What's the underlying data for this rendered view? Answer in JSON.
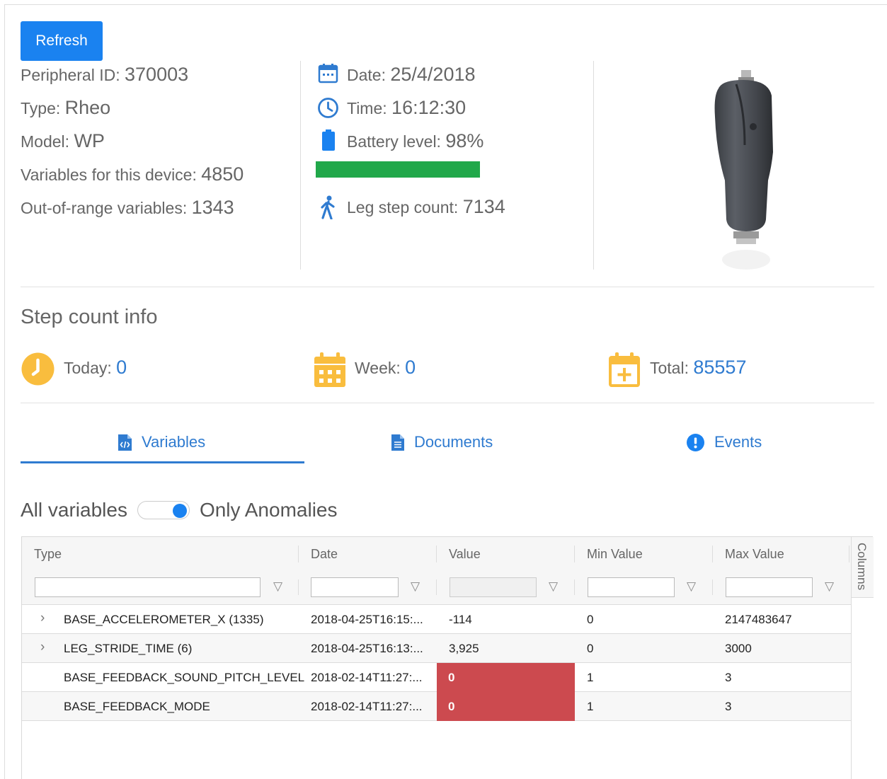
{
  "toolbar": {
    "refresh_label": "Refresh"
  },
  "device_info": {
    "peripheral_label": "Peripheral ID: ",
    "peripheral_value": "370003",
    "type_label": "Type: ",
    "type_value": "Rheo",
    "model_label": "Model: ",
    "model_value": "WP",
    "variables_label": "Variables for this device: ",
    "variables_value": "4850",
    "out_of_range_label": "Out-of-range variables: ",
    "out_of_range_value": "1343"
  },
  "status": {
    "date_label": "Date: ",
    "date_value": "25/4/2018",
    "time_label": "Time: ",
    "time_value": "16:12:30",
    "battery_label": "Battery level: ",
    "battery_value": "98%",
    "battery_level": 0.98,
    "battery_color": "#21a84a",
    "leg_step_label": "Leg step count: ",
    "leg_step_value": "7134"
  },
  "step_count": {
    "title": "Step count info",
    "today_label": "Today: ",
    "today_value": "0",
    "week_label": "Week: ",
    "week_value": "0",
    "total_label": "Total: ",
    "total_value": "85557"
  },
  "tabs": [
    {
      "label": "Variables",
      "icon": "code-file-icon",
      "active": true
    },
    {
      "label": "Documents",
      "icon": "document-icon",
      "active": false
    },
    {
      "label": "Events",
      "icon": "exclamation-circle-icon",
      "active": false
    }
  ],
  "filter_toggle": {
    "left_label": "All variables",
    "right_label": "Only Anomalies",
    "checked": true
  },
  "grid": {
    "columns": [
      "Type",
      "Date",
      "Value",
      "Min Value",
      "Max Value"
    ],
    "side_panel_label": "Columns",
    "rows": [
      {
        "type": "BASE_ACCELEROMETER_X (1335)",
        "date": "2018-04-25T16:15:...",
        "value": "-114",
        "min": "0",
        "max": "2147483647",
        "expandable": true,
        "anomaly": false
      },
      {
        "type": "LEG_STRIDE_TIME (6)",
        "date": "2018-04-25T16:13:...",
        "value": "3,925",
        "min": "0",
        "max": "3000",
        "expandable": true,
        "anomaly": false
      },
      {
        "type": "BASE_FEEDBACK_SOUND_PITCH_LEVEL",
        "date": "2018-02-14T11:27:...",
        "value": "0",
        "min": "1",
        "max": "3",
        "expandable": false,
        "anomaly": true
      },
      {
        "type": "BASE_FEEDBACK_MODE",
        "date": "2018-02-14T11:27:...",
        "value": "0",
        "min": "1",
        "max": "3",
        "expandable": false,
        "anomaly": true
      }
    ]
  },
  "colors": {
    "accent": "#1a82f0",
    "link": "#2f7bd0",
    "anomaly": "#cc4a4f",
    "step_icons": "#f9bd3e"
  }
}
